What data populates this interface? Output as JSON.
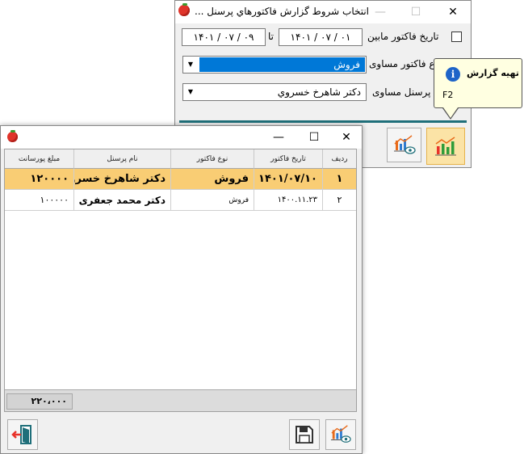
{
  "filter_window": {
    "title": "انتخاب شروط گزارش فاکتورهاي پرسنل ...",
    "minimize": "—",
    "maximize": "☐",
    "close": "✕",
    "date_between_label": "تاريخ فاکتور مابين",
    "date_from": "۱۴۰۱ / ۰۷ / ۰۱",
    "date_to_label": "تا",
    "date_to": "۱۴۰۱ / ۰۷ / ۰۹",
    "invoice_type_label": "ع فاکتور مساوی",
    "invoice_type_value": "فروش",
    "personnel_label": "پرسنل مساوی",
    "personnel_value": "دکتر شاهرخ خسروي"
  },
  "tooltip": {
    "title": "تهيه گزارش",
    "shortcut": "F2"
  },
  "report_window": {
    "minimize": "—",
    "maximize": "☐",
    "close": "✕",
    "columns": [
      "رديف",
      "تاريخ فاکتور",
      "نوع فاکتور",
      "نام پرسنل",
      "مبلغ پورسانت"
    ],
    "rows": [
      {
        "row": "۱",
        "date": "۱۴۰۱/۰۷/۱۰",
        "type": "فروش",
        "name": "دکتر شاهرخ خسروی",
        "amount": "۱۲۰۰۰۰"
      },
      {
        "row": "۲",
        "date": "۱۴۰۰.۱۱.۲۳",
        "type": "فروش",
        "name": "دکتر محمد جعفری",
        "amount": "۱۰۰۰۰۰"
      }
    ],
    "total": "۲۲۰،۰۰۰"
  },
  "colors": {
    "accent": "#1f6f7a",
    "selection_blue": "#0078d7",
    "row_highlight": "#f9cd74",
    "button_active": "#fbe3a6"
  }
}
